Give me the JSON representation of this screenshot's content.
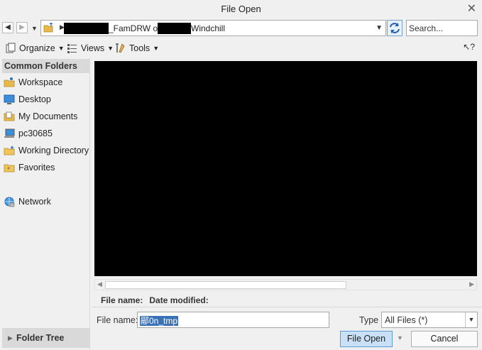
{
  "window": {
    "title": "File Open"
  },
  "address": {
    "segment1": "_FamDRW on",
    "segment2": "Windchill",
    "search_placeholder": "Search..."
  },
  "toolbar": {
    "organize": "Organize",
    "views": "Views",
    "tools": "Tools",
    "help": "?"
  },
  "sidebar": {
    "heading": "Common Folders",
    "items": [
      {
        "label": "Workspace",
        "icon": "workspace-icon"
      },
      {
        "label": "Desktop",
        "icon": "desktop-icon"
      },
      {
        "label": "My Documents",
        "icon": "documents-icon"
      },
      {
        "label": "pc30685",
        "icon": "computer-icon"
      },
      {
        "label": "Working Directory",
        "icon": "working-directory-icon"
      },
      {
        "label": "Favorites",
        "icon": "favorites-icon"
      },
      {
        "label": "Network",
        "icon": "network-icon"
      }
    ],
    "folder_tree": "Folder Tree"
  },
  "preview": {
    "file_name_label": "File name:",
    "date_modified_label": "Date modified:"
  },
  "footer": {
    "file_name_label": "File name:",
    "file_name_value": "\u0000n_tmp",
    "file_name_display": "䣓0n_tmp",
    "type_label": "Type",
    "type_value": "All Files (*)",
    "open_button": "File Open",
    "cancel_button": "Cancel"
  },
  "colors": {
    "accent": "#3b72b6",
    "open_button_bg": "#c9e0f7"
  }
}
